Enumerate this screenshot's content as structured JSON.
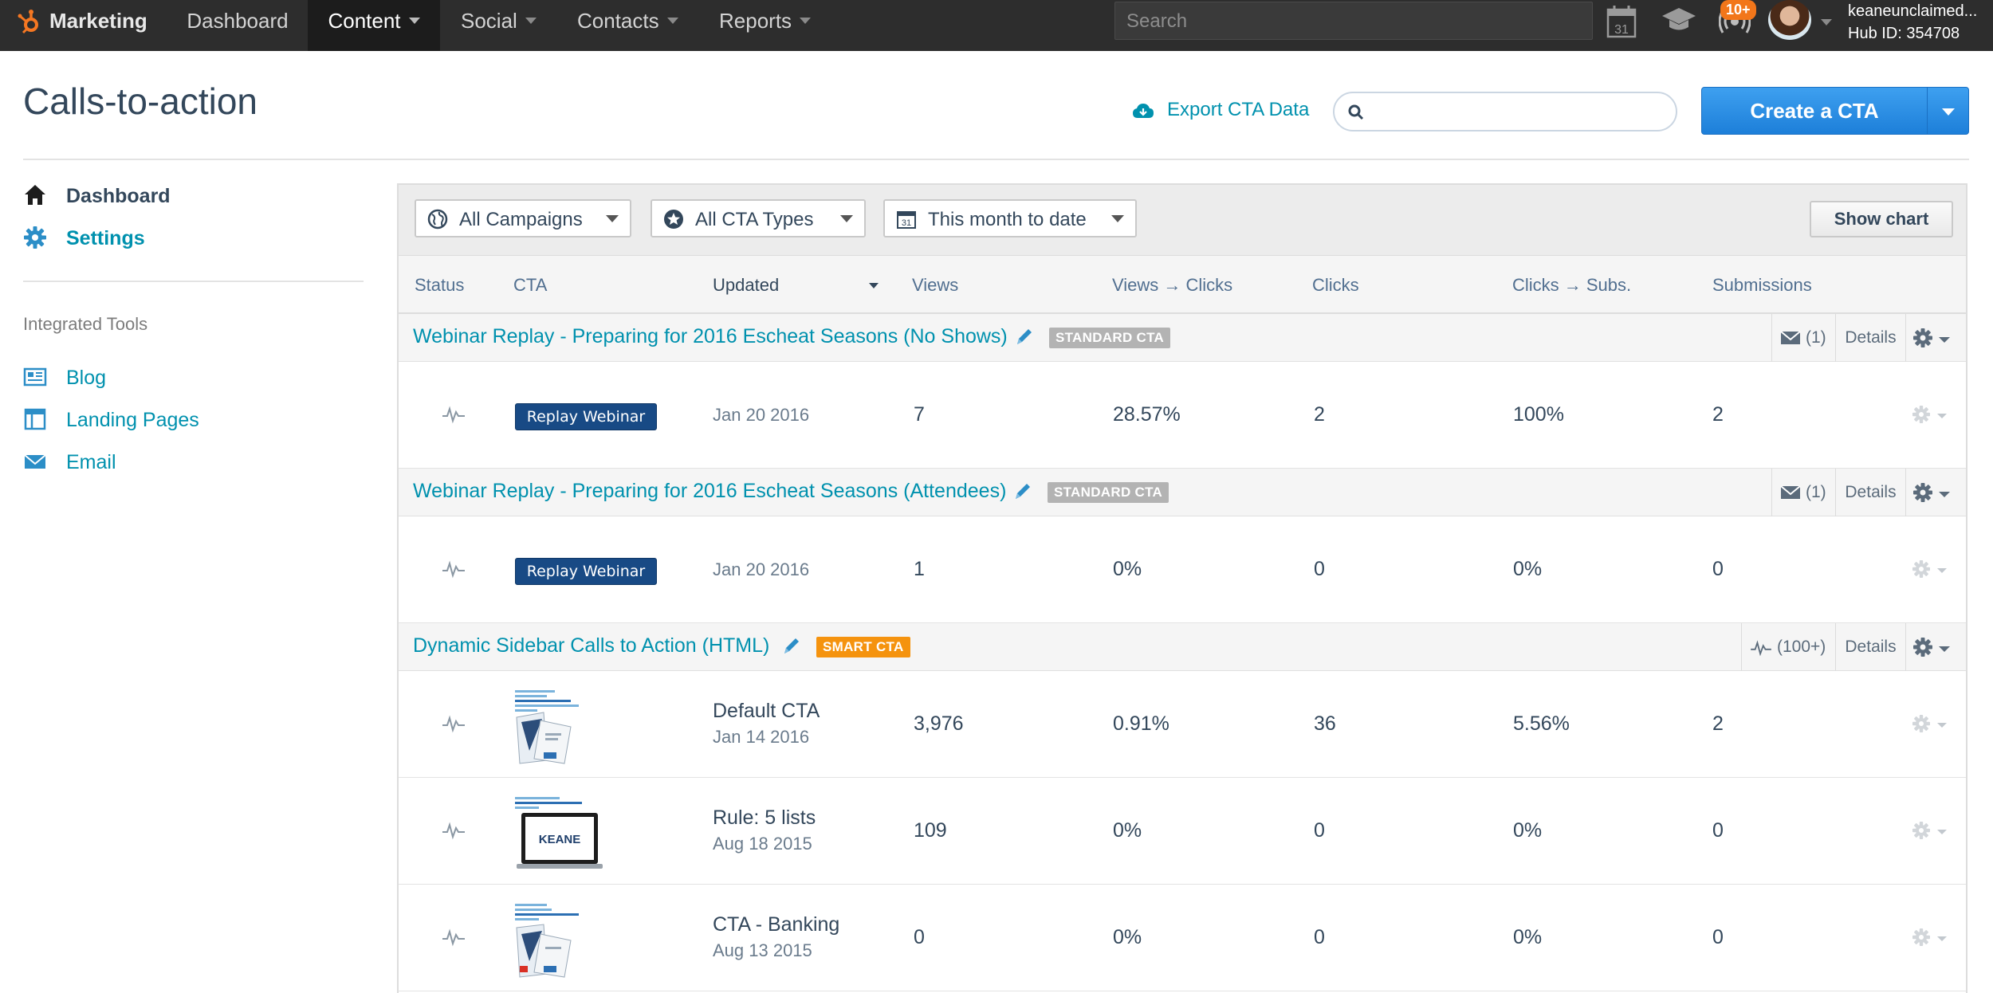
{
  "topnav": {
    "brand": "Marketing",
    "items": [
      {
        "label": "Dashboard"
      },
      {
        "label": "Content"
      },
      {
        "label": "Social"
      },
      {
        "label": "Contacts"
      },
      {
        "label": "Reports"
      }
    ],
    "search_placeholder": "Search",
    "calendar_day": "31",
    "notification_badge": "10+",
    "account_name": "keaneunclaimed...",
    "hub_id": "Hub ID: 354708"
  },
  "header": {
    "title": "Calls-to-action",
    "export_label": "Export CTA Data",
    "search_placeholder": "",
    "create_label": "Create a CTA"
  },
  "sidebar": {
    "primary": [
      {
        "label": "Dashboard",
        "icon": "home-icon"
      },
      {
        "label": "Settings",
        "icon": "gear-icon"
      }
    ],
    "tools_heading": "Integrated Tools",
    "tools": [
      {
        "label": "Blog",
        "icon": "blog-icon"
      },
      {
        "label": "Landing Pages",
        "icon": "landing-pages-icon"
      },
      {
        "label": "Email",
        "icon": "email-icon"
      }
    ]
  },
  "filters": {
    "campaigns": "All Campaigns",
    "cta_types": "All CTA Types",
    "date_range": "This month to date",
    "calendar_day": "31",
    "show_chart": "Show chart"
  },
  "table": {
    "columns": [
      "Status",
      "CTA",
      "Updated",
      "Views",
      "Views → Clicks",
      "Clicks",
      "Clicks → Subs.",
      "Submissions"
    ],
    "groups": [
      {
        "title": "Webinar Replay - Preparing for 2016 Escheat Seasons (No Shows)",
        "tag": "STANDARD CTA",
        "count": "(1)",
        "details": "Details",
        "rows": [
          {
            "button": "Replay Webinar",
            "name": "",
            "updated": "Jan 20 2016",
            "views": "7",
            "views_clicks": "28.57%",
            "clicks": "2",
            "clicks_subs": "100%",
            "submissions": "2"
          }
        ]
      },
      {
        "title": "Webinar Replay - Preparing for 2016 Escheat Seasons (Attendees)",
        "tag": "STANDARD CTA",
        "count": "(1)",
        "details": "Details",
        "rows": [
          {
            "button": "Replay Webinar",
            "name": "",
            "updated": "Jan 20 2016",
            "views": "1",
            "views_clicks": "0%",
            "clicks": "0",
            "clicks_subs": "0%",
            "submissions": "0"
          }
        ]
      },
      {
        "title": "Dynamic Sidebar Calls to Action (HTML)",
        "tag": "SMART CTA",
        "count": "(100+)",
        "details": "Details",
        "rows": [
          {
            "name": "Default CTA",
            "updated": "Jan 14 2016",
            "views": "3,976",
            "views_clicks": "0.91%",
            "clicks": "36",
            "clicks_subs": "5.56%",
            "submissions": "2"
          },
          {
            "name": "Rule: 5 lists",
            "updated": "Aug 18 2015",
            "views": "109",
            "views_clicks": "0%",
            "clicks": "0",
            "clicks_subs": "0%",
            "submissions": "0",
            "thumb_logo": "KEANE"
          },
          {
            "name": "CTA - Banking",
            "updated": "Aug 13 2015",
            "views": "0",
            "views_clicks": "0%",
            "clicks": "0",
            "clicks_subs": "0%",
            "submissions": "0"
          }
        ]
      }
    ]
  },
  "colors": {
    "nav_bg": "#2d2d2d",
    "link": "#0091ae",
    "primary_button": "#2a8fe6",
    "cta_button": "#184a85",
    "smart_tag": "#f5930e",
    "standard_tag": "#b3b3b3",
    "badge": "#f2761a"
  }
}
